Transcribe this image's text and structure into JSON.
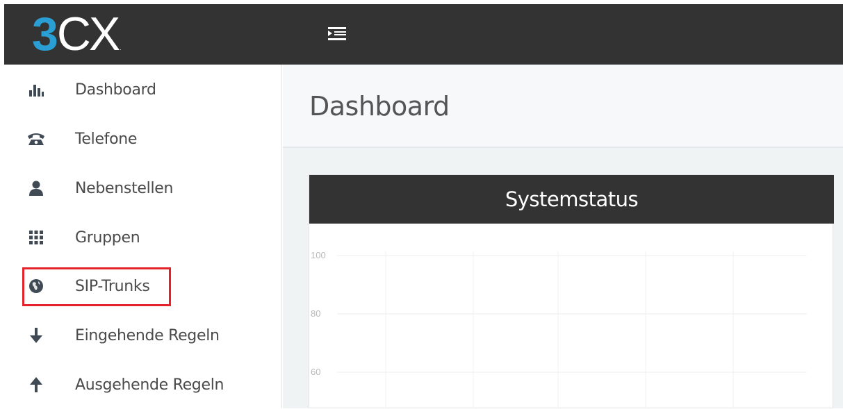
{
  "app": {
    "logo_number": "3",
    "logo_letters": "CX",
    "logo_mark": "."
  },
  "sidebar": {
    "items": [
      {
        "label": "Dashboard",
        "icon": "bar-chart-icon"
      },
      {
        "label": "Telefone",
        "icon": "phone-icon"
      },
      {
        "label": "Nebenstellen",
        "icon": "user-icon"
      },
      {
        "label": "Gruppen",
        "icon": "grid-icon"
      },
      {
        "label": "SIP-Trunks",
        "icon": "globe-icon",
        "highlighted": true
      },
      {
        "label": "Eingehende Regeln",
        "icon": "arrow-down-icon"
      },
      {
        "label": "Ausgehende Regeln",
        "icon": "arrow-up-icon"
      }
    ]
  },
  "main": {
    "page_title": "Dashboard",
    "panel": {
      "title": "Systemstatus"
    }
  },
  "colors": {
    "topbar": "#333333",
    "logo_accent": "#2a9fd6",
    "highlight": "#e32229"
  },
  "chart_data": {
    "type": "line",
    "title": "Systemstatus",
    "y_ticks": [
      "100",
      "80",
      "60"
    ],
    "ylim": [
      60,
      100
    ],
    "grid": true,
    "series": []
  }
}
